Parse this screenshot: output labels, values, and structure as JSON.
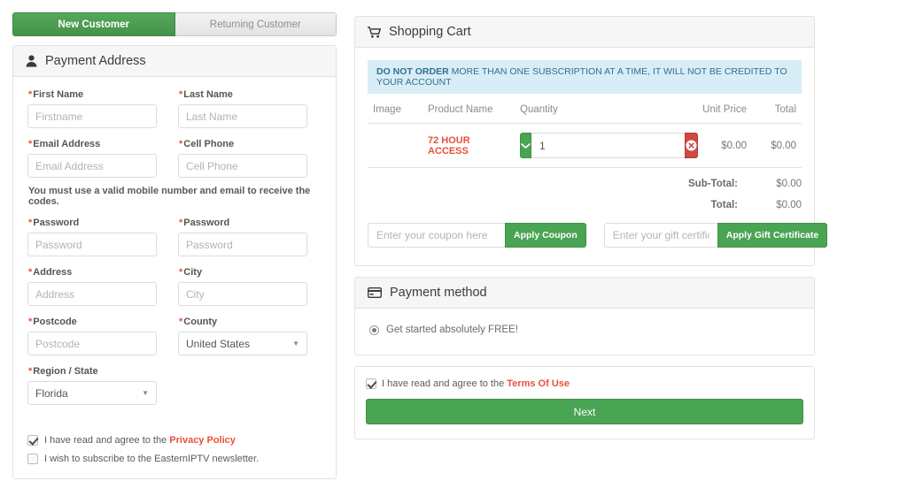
{
  "tabs": [
    {
      "label": "New Customer",
      "active": true
    },
    {
      "label": "Returning Customer",
      "active": false
    }
  ],
  "payment_address": {
    "title": "Payment Address",
    "icon": "user-icon",
    "hint": "You must use a valid mobile number and email to receive the codes.",
    "fields": [
      {
        "label": "First Name",
        "placeholder": "Firstname",
        "value": "",
        "required": true,
        "type": "text"
      },
      {
        "label": "Last Name",
        "placeholder": "Last Name",
        "value": "",
        "required": true,
        "type": "text"
      },
      {
        "label": "Email Address",
        "placeholder": "Email Address",
        "value": "",
        "required": true,
        "type": "text"
      },
      {
        "label": "Cell Phone",
        "placeholder": "Cell Phone",
        "value": "",
        "required": true,
        "type": "text"
      },
      {
        "label": "Password",
        "placeholder": "Password",
        "value": "",
        "required": true,
        "type": "password"
      },
      {
        "label": "Password",
        "placeholder": "Password",
        "value": "",
        "required": true,
        "type": "password"
      },
      {
        "label": "Address",
        "placeholder": "Address",
        "value": "",
        "required": true,
        "type": "text"
      },
      {
        "label": "City",
        "placeholder": "City",
        "value": "",
        "required": true,
        "type": "text"
      },
      {
        "label": "Postcode",
        "placeholder": "Postcode",
        "value": "",
        "required": true,
        "type": "text"
      },
      {
        "label": "County",
        "placeholder": "",
        "value": "United States",
        "required": true,
        "type": "select"
      },
      {
        "label": "Region / State",
        "placeholder": "",
        "value": "Florida",
        "required": true,
        "type": "select"
      }
    ],
    "checkboxes": [
      {
        "checked": true,
        "text_before": "I have read and agree to the ",
        "link": "Privacy Policy",
        "text_after": ""
      },
      {
        "checked": false,
        "text_before": "I wish to subscribe to the EasternIPTV newsletter.",
        "link": "",
        "text_after": ""
      }
    ]
  },
  "cart": {
    "title": "Shopping Cart",
    "icon": "cart-icon",
    "alert": {
      "bold": "DO NOT ORDER",
      "rest": " MORE THAN ONE SUBSCRIPTION AT A TIME, IT WILL NOT BE CREDITED TO YOUR ACCOUNT"
    },
    "columns": [
      "Image",
      "Product Name",
      "Quantity",
      "Unit Price",
      "Total"
    ],
    "rows": [
      {
        "image": "",
        "product_name": "72 HOUR ACCESS",
        "quantity": "1",
        "unit_price": "$0.00",
        "total": "$0.00"
      }
    ],
    "totals": [
      {
        "label": "Sub-Total:",
        "value": "$0.00"
      },
      {
        "label": "Total:",
        "value": "$0.00"
      }
    ],
    "coupon": {
      "placeholder": "Enter your coupon here",
      "value": "",
      "button": "Apply Coupon"
    },
    "gift": {
      "placeholder": "Enter your gift certific",
      "value": "",
      "button": "Apply Gift Certificate"
    }
  },
  "payment_method": {
    "title": "Payment method",
    "icon": "credit-card-icon",
    "options": [
      {
        "label": "Get started absolutely FREE!",
        "selected": true
      }
    ]
  },
  "footer": {
    "terms": {
      "checked": true,
      "text_before": "I have read and agree to the ",
      "link": "Terms Of Use"
    },
    "next_label": "Next"
  },
  "colors": {
    "green": "#49a453",
    "red": "#ce4a42",
    "link_red": "#e8503a",
    "alert_bg": "#d9edf7",
    "alert_text": "#31708f",
    "panel_head": "#f6f6f6",
    "border": "#e2e2e2"
  }
}
